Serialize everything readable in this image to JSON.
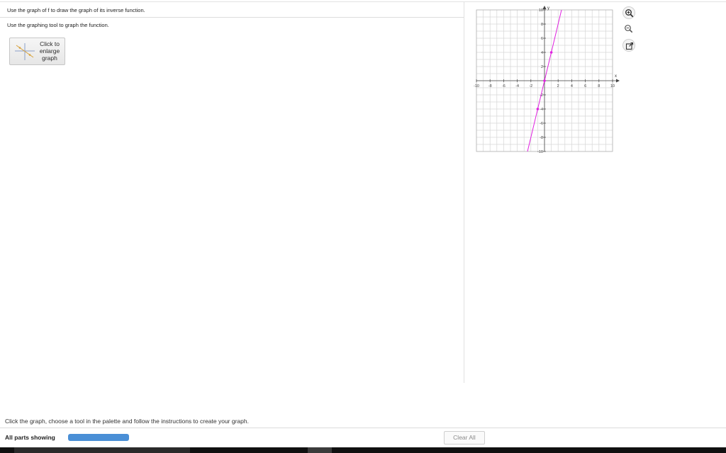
{
  "question": {
    "text": "Use the graph of f to draw the graph of its inverse function.",
    "instruction": "Use the graphing tool to graph the function."
  },
  "enlarge_button": {
    "label_line1": "Click to",
    "label_line2": "enlarge",
    "label_line3": "graph"
  },
  "graph": {
    "x_axis_label": "x",
    "y_axis_label": "y",
    "x_range": [
      -10,
      10
    ],
    "y_range": [
      -10,
      10
    ],
    "grid": true,
    "x_tick_labels": [
      "-10",
      "-8",
      "-6",
      "-4",
      "-2",
      "2",
      "4",
      "6",
      "8",
      "10"
    ],
    "y_tick_labels": [
      "10",
      "8",
      "6",
      "4",
      "2",
      "-2",
      "-4",
      "-6",
      "-8",
      "-10"
    ],
    "line_color": "#e020e0",
    "line_points": [
      [
        -2.5,
        -10
      ],
      [
        2.5,
        10
      ]
    ],
    "marked_points": [
      [
        -1,
        -4
      ],
      [
        0,
        0
      ],
      [
        1,
        4
      ]
    ]
  },
  "tools": {
    "zoom_in_icon": "zoom-in-icon",
    "zoom_out_icon": "zoom-out-icon",
    "popout_icon": "popout-icon"
  },
  "footer": {
    "hint": "Click the graph, choose a tool in the palette and follow the instructions to create your graph.",
    "parts_label": "All parts showing",
    "clear_label": "Clear All",
    "progress_color": "#4a8fd6"
  }
}
